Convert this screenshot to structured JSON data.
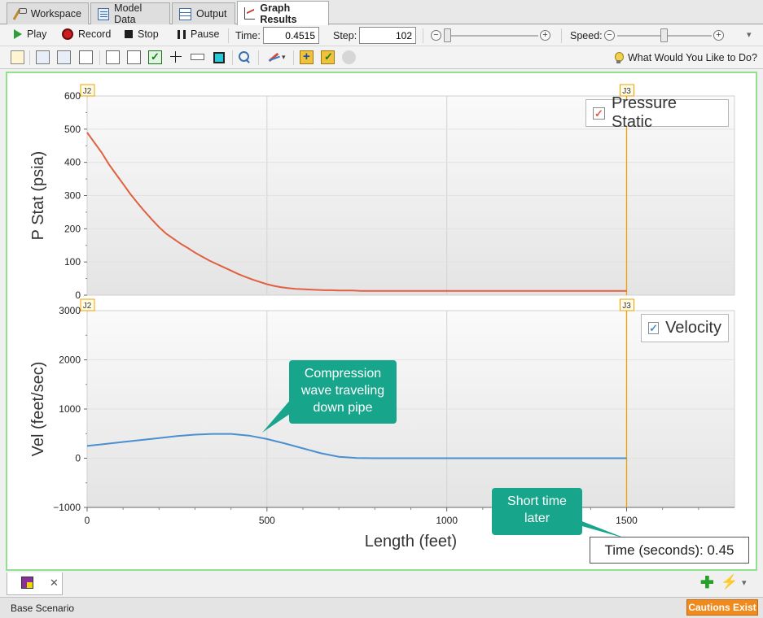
{
  "tabs": [
    {
      "label": "Workspace",
      "icon": "workspace-icon"
    },
    {
      "label": "Model Data",
      "icon": "model-data-icon"
    },
    {
      "label": "Output",
      "icon": "output-icon"
    },
    {
      "label": "Graph Results",
      "icon": "graph-results-icon",
      "active": true
    }
  ],
  "toolbar": {
    "play_label": "Play",
    "record_label": "Record",
    "stop_label": "Stop",
    "pause_label": "Pause",
    "time_label": "Time:",
    "time_value": "0.4515",
    "step_label": "Step:",
    "step_value": "102",
    "speed_label": "Speed:",
    "minus_glyph": "−",
    "plus_glyph": "+",
    "dropdown_glyph": "▾",
    "help_label": "What Would You Like to Do?"
  },
  "chart_data": [
    {
      "type": "line",
      "ylabel": "P Stat (psia)",
      "ylim": [
        0,
        600
      ],
      "yticks": [
        "0",
        "100",
        "200",
        "300",
        "400",
        "500",
        "600"
      ],
      "xlim": [
        0,
        1800
      ],
      "grid": true,
      "legend": {
        "text": "Pressure Static",
        "placement": "top-right",
        "checked": true,
        "color": "#e06040"
      },
      "markers": [
        {
          "label": "J2",
          "x": 0
        },
        {
          "label": "J3",
          "x": 1500
        }
      ],
      "series": [
        {
          "color": "#e06040",
          "x": [
            0,
            20,
            40,
            60,
            80,
            100,
            120,
            140,
            160,
            180,
            200,
            220,
            240,
            260,
            280,
            300,
            320,
            340,
            360,
            380,
            400,
            420,
            440,
            460,
            480,
            500,
            520,
            540,
            560,
            580,
            600,
            620,
            640,
            660,
            680,
            700,
            720,
            740,
            760,
            800,
            900,
            1000,
            1100,
            1200,
            1300,
            1400,
            1500
          ],
          "y": [
            490,
            460,
            430,
            395,
            365,
            335,
            305,
            278,
            252,
            228,
            205,
            185,
            170,
            155,
            142,
            128,
            116,
            104,
            94,
            84,
            74,
            64,
            55,
            47,
            40,
            33,
            28,
            24,
            21,
            19,
            18,
            17,
            16,
            15,
            15,
            14,
            14,
            14,
            13,
            13,
            13,
            13,
            13,
            13,
            13,
            13,
            13
          ]
        }
      ]
    },
    {
      "type": "line",
      "ylabel": "Vel (feet/sec)",
      "xlabel": "Length (feet)",
      "ylim": [
        -1000,
        3000
      ],
      "yticks": [
        "−1000",
        "0",
        "1000",
        "2000",
        "3000"
      ],
      "xlim": [
        0,
        1800
      ],
      "xticks": [
        "0",
        "500",
        "1000",
        "1500"
      ],
      "grid": true,
      "legend": {
        "text": "Velocity",
        "placement": "top-right",
        "checked": true,
        "color": "#4a8fcf"
      },
      "markers": [
        {
          "label": "J2",
          "x": 0
        },
        {
          "label": "J3",
          "x": 1500
        }
      ],
      "series": [
        {
          "color": "#4a8fcf",
          "x": [
            0,
            50,
            100,
            150,
            200,
            250,
            300,
            350,
            400,
            450,
            500,
            550,
            600,
            650,
            700,
            750,
            800,
            900,
            1000,
            1100,
            1200,
            1300,
            1400,
            1500
          ],
          "y": [
            250,
            290,
            330,
            370,
            410,
            450,
            480,
            495,
            495,
            460,
            390,
            300,
            200,
            100,
            30,
            5,
            0,
            0,
            0,
            0,
            0,
            0,
            0,
            0
          ]
        }
      ]
    }
  ],
  "annotations": {
    "compression": "Compression wave traveling down pipe",
    "short_time": "Short time later"
  },
  "time_box": "Time (seconds): 0.45",
  "status": {
    "scenario": "Base Scenario",
    "cautions": "Cautions Exist"
  },
  "colors": {
    "accent_green": "#8fe08f",
    "annotation": "#17a68c",
    "marker": "#f0a000",
    "cautions": "#f08a1c"
  }
}
